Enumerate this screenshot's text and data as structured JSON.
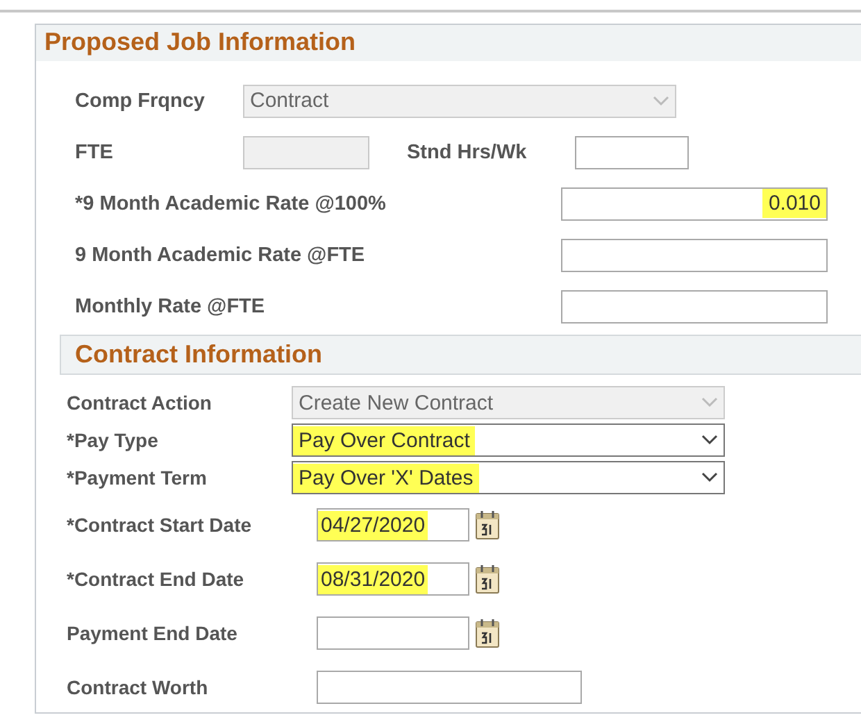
{
  "sections": [
    {
      "title": "Proposed Job Information",
      "rows": [
        {
          "kind": "select",
          "label": "Comp Frqncy",
          "value": "Contract",
          "disabled": true,
          "highlighted": false
        },
        {
          "kind": "pair",
          "label": "FTE",
          "value": "",
          "disabled": true,
          "label_2": "Stnd Hrs/Wk",
          "value_2": ""
        },
        {
          "kind": "rate",
          "label": "*9 Month Academic Rate @100%",
          "value": "0.010",
          "highlighted": true
        },
        {
          "kind": "rate",
          "label": "9 Month Academic Rate @FTE",
          "value": ""
        },
        {
          "kind": "rate",
          "label": "Monthly Rate @FTE",
          "value": ""
        }
      ]
    },
    {
      "title": "Contract Information",
      "rows": [
        {
          "kind": "select",
          "label": "Contract Action",
          "value": "Create New Contract",
          "disabled": true,
          "highlighted": false
        },
        {
          "kind": "select",
          "label": "*Pay Type",
          "value": "Pay Over Contract",
          "disabled": false,
          "highlighted": true
        },
        {
          "kind": "select",
          "label": "*Payment Term",
          "value": "Pay Over 'X' Dates",
          "disabled": false,
          "highlighted": true
        },
        {
          "kind": "date",
          "label": "*Contract Start Date",
          "value": "04/27/2020",
          "highlighted": true
        },
        {
          "kind": "date",
          "label": "*Contract End Date",
          "value": "08/31/2020",
          "highlighted": true
        },
        {
          "kind": "date",
          "label": "Payment End Date",
          "value": ""
        },
        {
          "kind": "text",
          "label": "Contract Worth",
          "value": ""
        }
      ]
    }
  ]
}
